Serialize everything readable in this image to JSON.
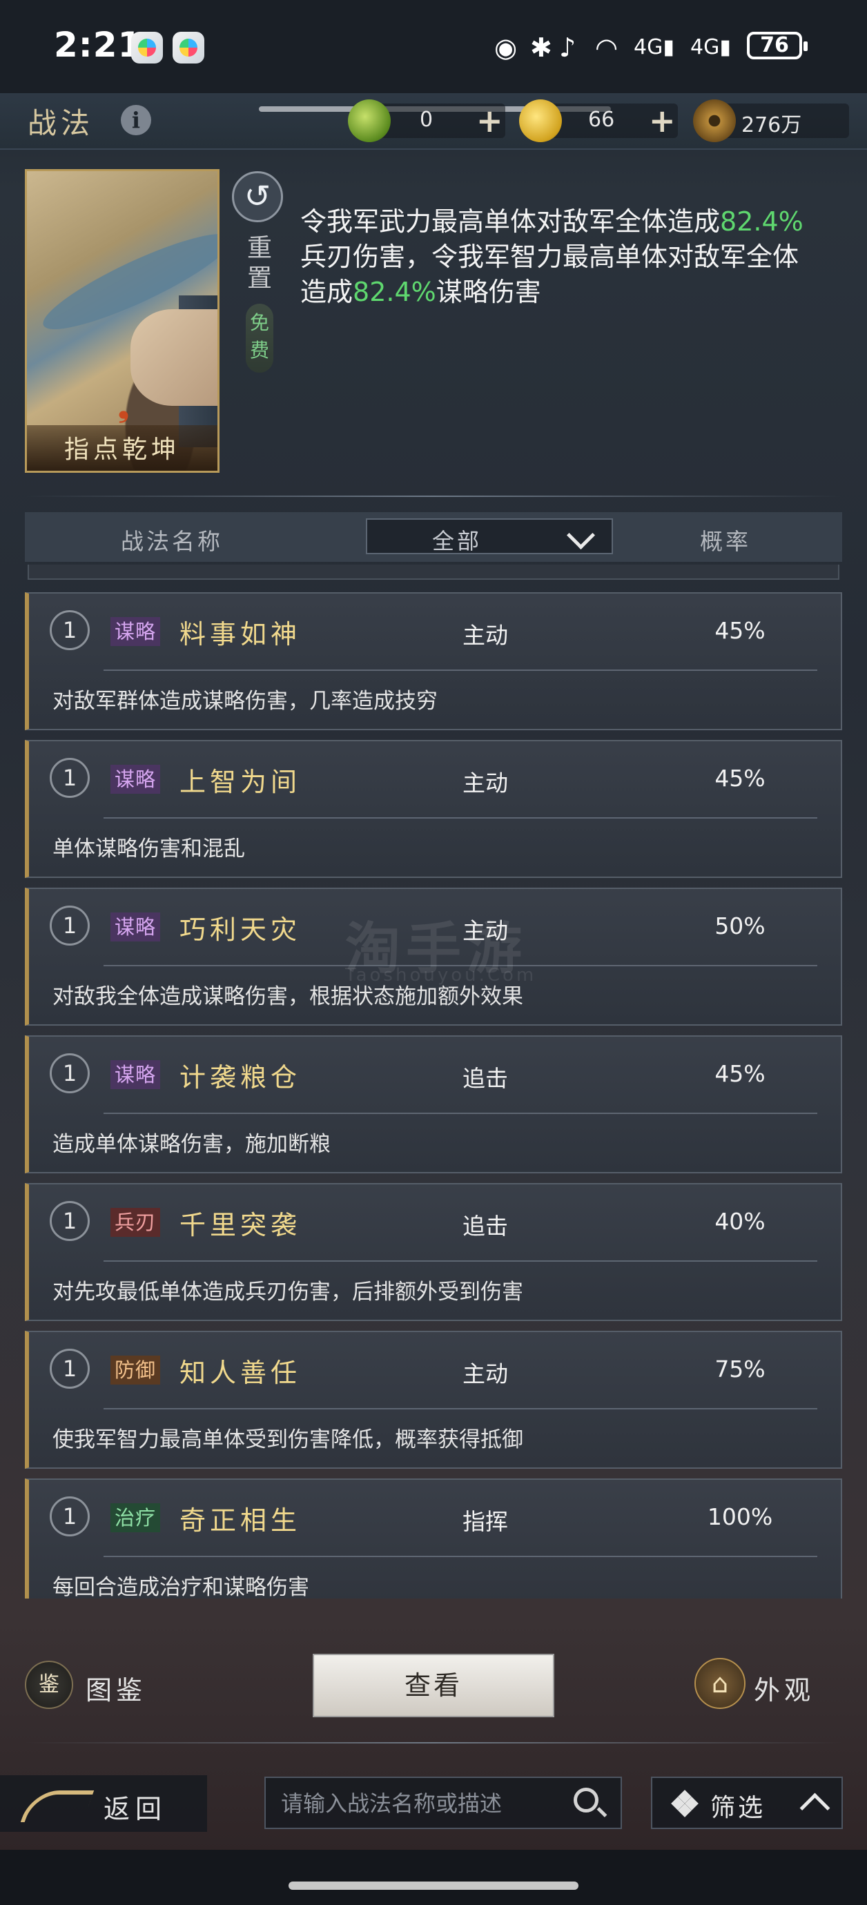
{
  "status_bar": {
    "time": "2:21",
    "icons": [
      "app-icon",
      "app-icon",
      "nfc-icon",
      "bluetooth-icon",
      "mute-icon",
      "wifi-icon",
      "signal-4g-icon",
      "signal-4g-icon"
    ],
    "net1": "4G",
    "net2": "4G",
    "battery": "76"
  },
  "header": {
    "title": "战法",
    "resources": [
      {
        "icon": "jade-icon",
        "value": "0",
        "plus": "+"
      },
      {
        "icon": "gold-icon",
        "value": "66",
        "plus": "+"
      },
      {
        "icon": "copper-coin-icon",
        "value": "276万"
      }
    ]
  },
  "selected": {
    "card_name": "指点乾坤",
    "reset_label": "重置",
    "free_label": "免费",
    "description_parts": [
      "令我军武力最高单体对敌军全体造成",
      "82.4%",
      "兵刃伤害，令我军智力最高单体对敌军全体造成",
      "82.4%",
      "谋略伤害"
    ]
  },
  "table": {
    "col_name": "战法名称",
    "filter_value": "全部",
    "col_rate": "概率"
  },
  "tactics": [
    {
      "level": "1",
      "tag": "谋略",
      "tag_kind": "mou",
      "name": "料事如神",
      "type": "主动",
      "rate": "45%",
      "desc": "对敌军群体造成谋略伤害，几率造成技穷"
    },
    {
      "level": "1",
      "tag": "谋略",
      "tag_kind": "mou",
      "name": "上智为间",
      "type": "主动",
      "rate": "45%",
      "desc": "单体谋略伤害和混乱"
    },
    {
      "level": "1",
      "tag": "谋略",
      "tag_kind": "mou",
      "name": "巧利天灾",
      "type": "主动",
      "rate": "50%",
      "desc": "对敌我全体造成谋略伤害，根据状态施加额外效果"
    },
    {
      "level": "1",
      "tag": "谋略",
      "tag_kind": "mou",
      "name": "计袭粮仓",
      "type": "追击",
      "rate": "45%",
      "desc": "造成单体谋略伤害，施加断粮"
    },
    {
      "level": "1",
      "tag": "兵刃",
      "tag_kind": "bing",
      "name": "千里突袭",
      "type": "追击",
      "rate": "40%",
      "desc": "对先攻最低单体造成兵刃伤害，后排额外受到伤害"
    },
    {
      "level": "1",
      "tag": "防御",
      "tag_kind": "fang",
      "name": "知人善任",
      "type": "主动",
      "rate": "75%",
      "desc": "使我军智力最高单体受到伤害降低，概率获得抵御"
    },
    {
      "level": "1",
      "tag": "治疗",
      "tag_kind": "zhi",
      "name": "奇正相生",
      "type": "指挥",
      "rate": "100%",
      "desc": "每回合造成治疗和谋略伤害"
    }
  ],
  "watermark": {
    "text": "淘手游",
    "sub": "Taoshouyou.Com"
  },
  "actions": {
    "atlas_icon_glyph": "鉴",
    "atlas_label": "图鉴",
    "view_label": "查看",
    "appearance_label": "外观"
  },
  "footer": {
    "back_label": "返回",
    "search_placeholder": "请输入战法名称或描述",
    "filter_label": "筛选"
  }
}
